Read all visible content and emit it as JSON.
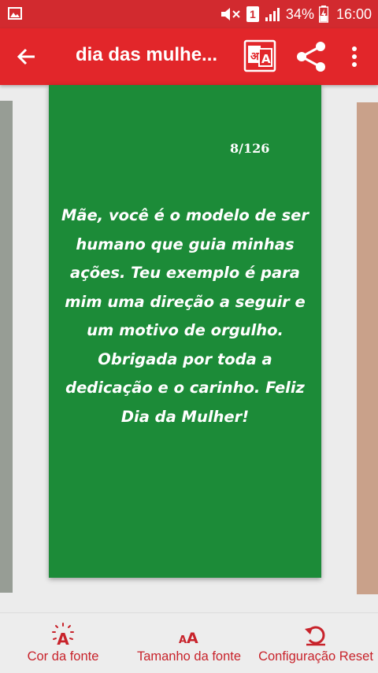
{
  "status_bar": {
    "sim": "1",
    "battery": "34%",
    "time": "16:00"
  },
  "app_bar": {
    "title": "dia das mulhe...",
    "icons": [
      "arrow-back-icon",
      "translate-icon",
      "share-icon",
      "more-vert-icon"
    ]
  },
  "card": {
    "counter": "8/126",
    "message": "Mãe, você é o modelo de ser humano que guia minhas ações. Teu exemplo é para mim uma direção a seguir e um motivo de orgulho. Obrigada por toda a dedicação e o carinho. Feliz Dia da Mulher!",
    "background_color": "#1c8b38",
    "text_color": "#ffffff"
  },
  "bottom_bar": {
    "font_color_label": "Cor da fonte",
    "font_size_label": "Tamanho da fonte",
    "reset_label": "Configuração Reset"
  },
  "colors": {
    "primary": "#e2262a",
    "status": "#d22a2f",
    "accent_text": "#c8232b"
  }
}
